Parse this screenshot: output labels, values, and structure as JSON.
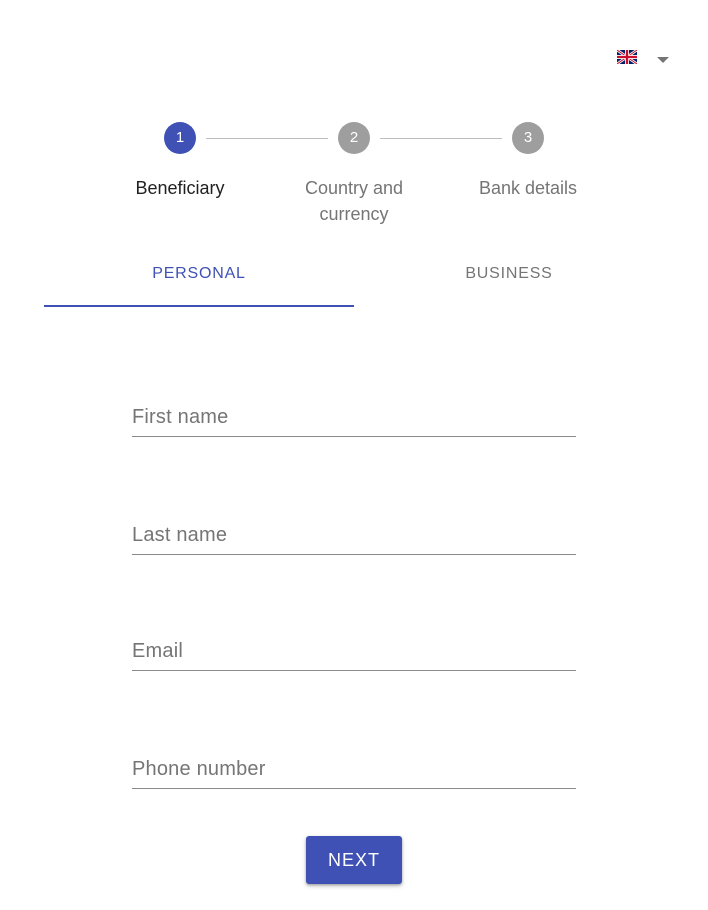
{
  "language": {
    "selected": "English (UK)",
    "flag_icon": "uk-flag-icon",
    "caret_icon": "caret-down-icon"
  },
  "stepper": {
    "steps": [
      {
        "number": "1",
        "label": "Beneficiary",
        "state": "active"
      },
      {
        "number": "2",
        "label": "Country and currency",
        "state": "inactive"
      },
      {
        "number": "3",
        "label": "Bank details",
        "state": "inactive"
      }
    ]
  },
  "tabs": [
    {
      "label": "PERSONAL",
      "selected": true
    },
    {
      "label": "BUSINESS",
      "selected": false
    }
  ],
  "form": {
    "first_name": {
      "label": "First name",
      "value": ""
    },
    "last_name": {
      "label": "Last name",
      "value": ""
    },
    "email": {
      "label": "Email",
      "value": ""
    },
    "phone": {
      "label": "Phone number",
      "value": ""
    }
  },
  "actions": {
    "next_label": "NEXT"
  },
  "colors": {
    "primary": "#3f51b5",
    "inactive_step": "#9e9e9e",
    "muted_text": "#757575"
  }
}
